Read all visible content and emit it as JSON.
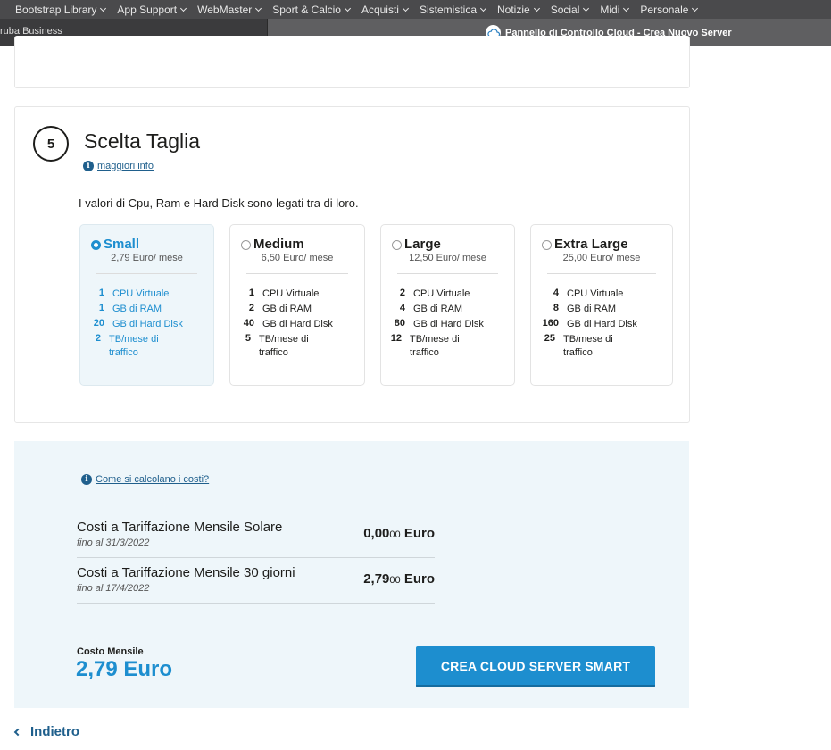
{
  "bookmarks": [
    "Bootstrap Library",
    "App Support",
    "WebMaster",
    "Sport & Calcio",
    "Acquisti",
    "Sistemistica",
    "Notizie",
    "Social",
    "Midi",
    "Personale"
  ],
  "tabs": {
    "inactive_title": "ruba Business",
    "active_title": "Pannello di Controllo Cloud - Crea Nuovo Server"
  },
  "size_section": {
    "step": "5",
    "title": "Scelta Taglia",
    "more_info": "maggiori info",
    "intro": "I valori di Cpu, Ram e Hard Disk sono legati tra di loro.",
    "options": [
      {
        "name": "Small",
        "price": "2,79 Euro",
        "per": "/ mese",
        "selected": true,
        "specs": [
          {
            "n": "1",
            "label": "CPU Virtuale"
          },
          {
            "n": "1",
            "label": "GB di RAM"
          },
          {
            "n": "20",
            "label": "GB di Hard Disk"
          },
          {
            "n": "2",
            "label": "TB/mese di traffico"
          }
        ]
      },
      {
        "name": "Medium",
        "price": "6,50 Euro",
        "per": "/ mese",
        "selected": false,
        "specs": [
          {
            "n": "1",
            "label": "CPU Virtuale"
          },
          {
            "n": "2",
            "label": "GB di RAM"
          },
          {
            "n": "40",
            "label": "GB di Hard Disk"
          },
          {
            "n": "5",
            "label": "TB/mese di traffico"
          }
        ]
      },
      {
        "name": "Large",
        "price": "12,50 Euro",
        "per": "/ mese",
        "selected": false,
        "specs": [
          {
            "n": "2",
            "label": "CPU Virtuale"
          },
          {
            "n": "4",
            "label": "GB di RAM"
          },
          {
            "n": "80",
            "label": "GB di Hard Disk"
          },
          {
            "n": "12",
            "label": "TB/mese di traffico"
          }
        ]
      },
      {
        "name": "Extra Large",
        "price": "25,00 Euro",
        "per": "/ mese",
        "selected": false,
        "specs": [
          {
            "n": "4",
            "label": "CPU Virtuale"
          },
          {
            "n": "8",
            "label": "GB di RAM"
          },
          {
            "n": "160",
            "label": "GB di Hard Disk"
          },
          {
            "n": "25",
            "label": "TB/mese di traffico"
          }
        ]
      }
    ]
  },
  "costs": {
    "calc_link": "Come si calcolano i costi?",
    "rows": [
      {
        "title": "Costi a Tariffazione Mensile Solare",
        "until": "fino al 31/3/2022",
        "amount_main": "0,00",
        "amount_dec": "00",
        "currency": "Euro"
      },
      {
        "title": "Costi a Tariffazione Mensile 30 giorni",
        "until": "fino al 17/4/2022",
        "amount_main": "2,79",
        "amount_dec": "00",
        "currency": "Euro"
      }
    ],
    "total_label": "Costo Mensile",
    "total_value": "2,79 Euro",
    "create_button": "CREA CLOUD SERVER SMART"
  },
  "back_label": "Indietro",
  "colors": {
    "accent": "#1d8ecf",
    "link": "#1f5f8c",
    "panel_bg": "#eef6fa"
  }
}
